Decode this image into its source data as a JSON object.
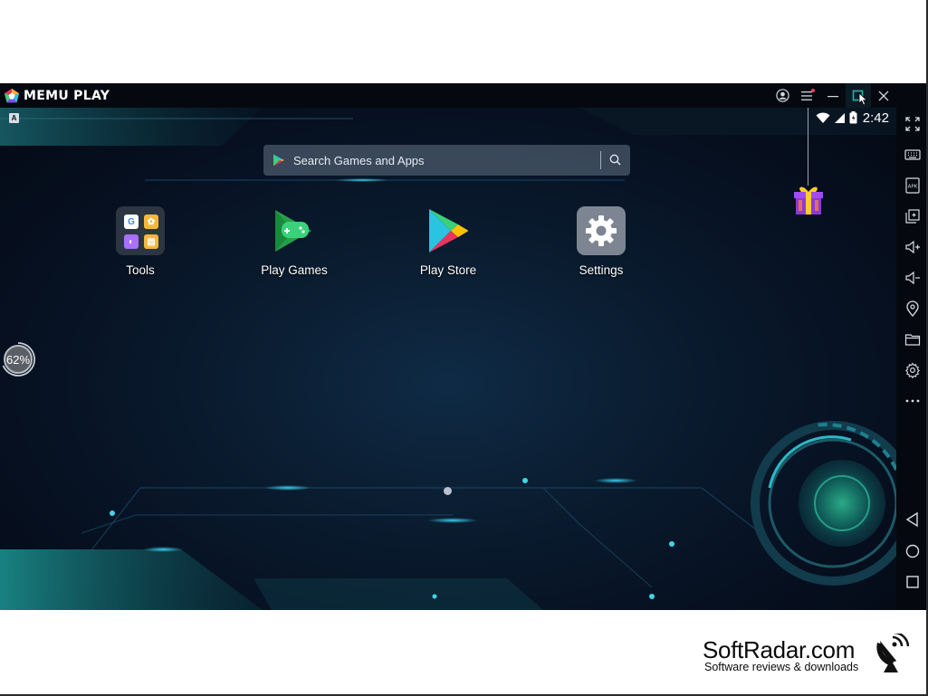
{
  "window": {
    "app_name": "MEMU PLAY",
    "accent_color": "#1fb5b0"
  },
  "statusbar": {
    "time": "2:42",
    "keyboard_indicator": "A"
  },
  "search": {
    "placeholder": "Search Games and Apps"
  },
  "apps": [
    {
      "label": "Tools",
      "icon": "tools-folder-icon"
    },
    {
      "label": "Play Games",
      "icon": "play-games-icon"
    },
    {
      "label": "Play Store",
      "icon": "play-store-icon"
    },
    {
      "label": "Settings",
      "icon": "settings-gear-icon"
    }
  ],
  "cpu_usage": "62%",
  "sidebar": {
    "items": [
      {
        "name": "collapse-icon"
      },
      {
        "name": "fullscreen-icon"
      },
      {
        "name": "keyboard-icon"
      },
      {
        "name": "apk-icon",
        "label": "APK"
      },
      {
        "name": "multi-window-icon"
      },
      {
        "name": "volume-up-icon"
      },
      {
        "name": "volume-down-icon"
      },
      {
        "name": "location-icon"
      },
      {
        "name": "folder-icon"
      },
      {
        "name": "settings-icon"
      },
      {
        "name": "more-icon"
      },
      {
        "name": "back-icon"
      },
      {
        "name": "home-icon"
      },
      {
        "name": "recents-icon"
      }
    ]
  },
  "watermark": {
    "title": "SoftRadar.com",
    "subtitle": "Software reviews & downloads"
  }
}
